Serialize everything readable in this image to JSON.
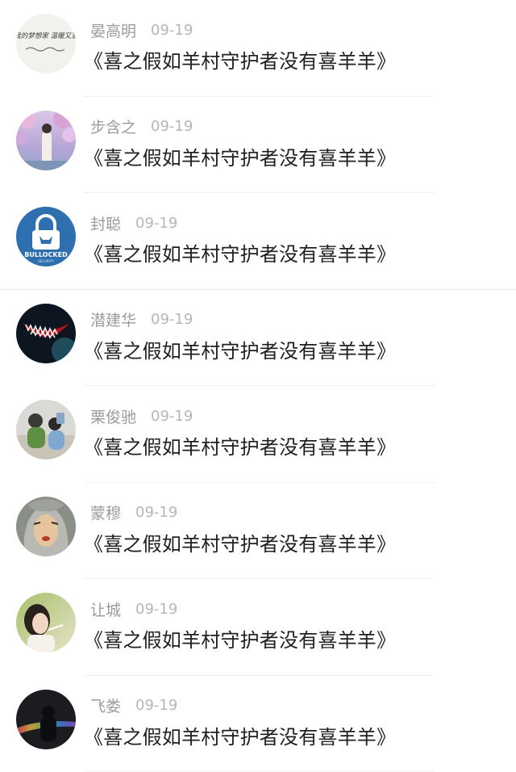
{
  "comments": [
    {
      "username": "晏高明",
      "date": "09-19",
      "text": "《喜之假如羊村守护者没有喜羊羊》",
      "avatar": "handwriting-avatar",
      "avatar_text": "做我的梦想家 温暖又激情"
    },
    {
      "username": "步含之",
      "date": "09-19",
      "text": "《喜之假如羊村守护者没有喜羊羊》",
      "avatar": "blossom-figure-avatar"
    },
    {
      "username": "封聪",
      "date": "09-19",
      "text": "《喜之假如羊村守护者没有喜羊羊》",
      "avatar": "bullocked-logo-avatar",
      "avatar_text": "BULLOCKED",
      "avatar_subtext": "SECURITY"
    },
    {
      "username": "潜建华",
      "date": "09-19",
      "text": "《喜之假如羊村守护者没有喜羊羊》",
      "avatar": "monster-grin-avatar"
    },
    {
      "username": "栗俊驰",
      "date": "09-19",
      "text": "《喜之假如羊村守护者没有喜羊羊》",
      "avatar": "people-photo-avatar"
    },
    {
      "username": "蒙穆",
      "date": "09-19",
      "text": "《喜之假如羊村守护者没有喜羊羊》",
      "avatar": "anime-face-avatar"
    },
    {
      "username": "让城",
      "date": "09-19",
      "text": "《喜之假如羊村守护者没有喜羊羊》",
      "avatar": "girl-portrait-avatar"
    },
    {
      "username": "飞娄",
      "date": "09-19",
      "text": "《喜之假如羊村守护者没有喜羊羊》",
      "avatar": "rainbow-silhouette-avatar"
    }
  ]
}
